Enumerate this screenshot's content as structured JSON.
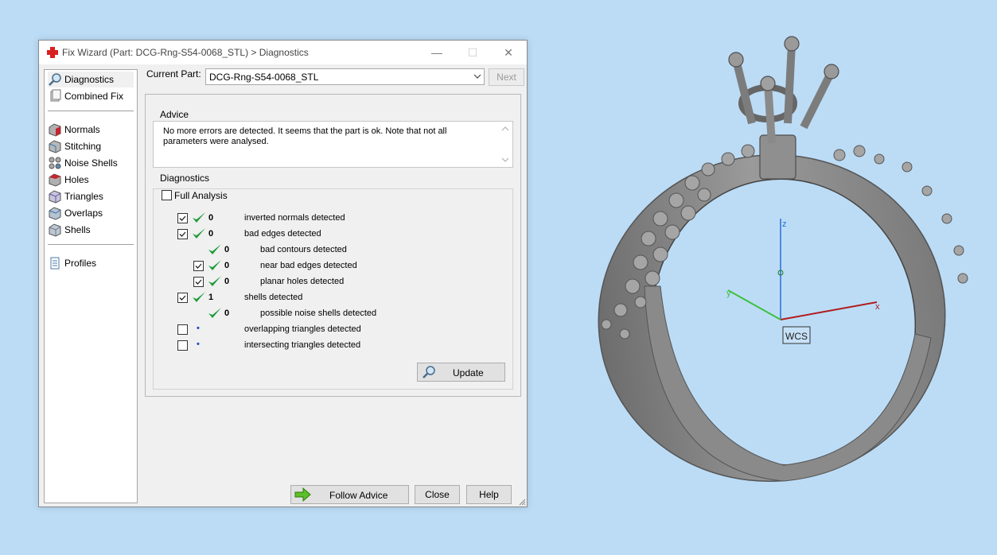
{
  "window": {
    "title": "Fix Wizard (Part: DCG-Rng-S54-0068_STL) > Diagnostics",
    "controls": [
      "—",
      "☐",
      "✕"
    ]
  },
  "nav": {
    "items": [
      {
        "label": "Diagnostics",
        "icon": "magnifier-icon",
        "active": true
      },
      {
        "label": "Combined Fix",
        "icon": "combined-fix-icon"
      },
      {
        "label": "Normals",
        "icon": "normals-icon"
      },
      {
        "label": "Stitching",
        "icon": "stitching-icon"
      },
      {
        "label": "Noise Shells",
        "icon": "noise-shells-icon"
      },
      {
        "label": "Holes",
        "icon": "holes-icon"
      },
      {
        "label": "Triangles",
        "icon": "triangles-icon"
      },
      {
        "label": "Overlaps",
        "icon": "overlaps-icon"
      },
      {
        "label": "Shells",
        "icon": "shells-icon"
      },
      {
        "label": "Profiles",
        "icon": "profiles-icon"
      }
    ]
  },
  "topbar": {
    "current_part_label": "Current Part:",
    "current_part_value": "DCG-Rng-S54-0068_STL",
    "next_label": "Next"
  },
  "advice": {
    "group_label": "Advice",
    "text": "No more errors are detected. It seems that the part is ok. Note that not all parameters were analysed."
  },
  "diagnostics": {
    "group_label": "Diagnostics",
    "full_analysis_label": "Full Analysis",
    "full_analysis_checked": false,
    "rows": [
      {
        "checkbox": true,
        "checked": true,
        "status": "ok",
        "count": "0",
        "label": "inverted normals detected",
        "indent": 0
      },
      {
        "checkbox": true,
        "checked": true,
        "status": "ok",
        "count": "0",
        "label": "bad edges detected",
        "indent": 0
      },
      {
        "checkbox": false,
        "checked": false,
        "status": "ok",
        "count": "0",
        "label": "bad contours detected",
        "indent": 1
      },
      {
        "checkbox": true,
        "checked": true,
        "status": "ok",
        "count": "0",
        "label": "near bad edges detected",
        "indent": 1
      },
      {
        "checkbox": true,
        "checked": true,
        "status": "ok",
        "count": "0",
        "label": "planar holes detected",
        "indent": 1
      },
      {
        "checkbox": true,
        "checked": true,
        "status": "ok",
        "count": "1",
        "label": "shells detected",
        "indent": 0
      },
      {
        "checkbox": false,
        "checked": false,
        "status": "ok",
        "count": "0",
        "label": "possible noise shells detected",
        "indent": 1
      },
      {
        "checkbox": true,
        "checked": false,
        "status": "unknown",
        "count": "•",
        "label": "overlapping triangles detected",
        "indent": 0
      },
      {
        "checkbox": true,
        "checked": false,
        "status": "unknown",
        "count": "•",
        "label": "intersecting triangles detected",
        "indent": 0
      }
    ],
    "update_label": "Update"
  },
  "footer": {
    "follow_advice_label": "Follow Advice",
    "close_label": "Close",
    "help_label": "Help"
  },
  "viewport": {
    "axis_z": "z",
    "axis_y": "y",
    "axis_x": "x",
    "wcs_label": "WCS"
  },
  "colors": {
    "desktop": "#bcdcf6",
    "check_green": "#1f9a3b",
    "app_icon_red": "#d82020",
    "axis_x": "#b01c1c",
    "axis_y": "#3cc13c",
    "axis_z": "#2a6fd6",
    "ring_gray": "#8d8d8d"
  }
}
